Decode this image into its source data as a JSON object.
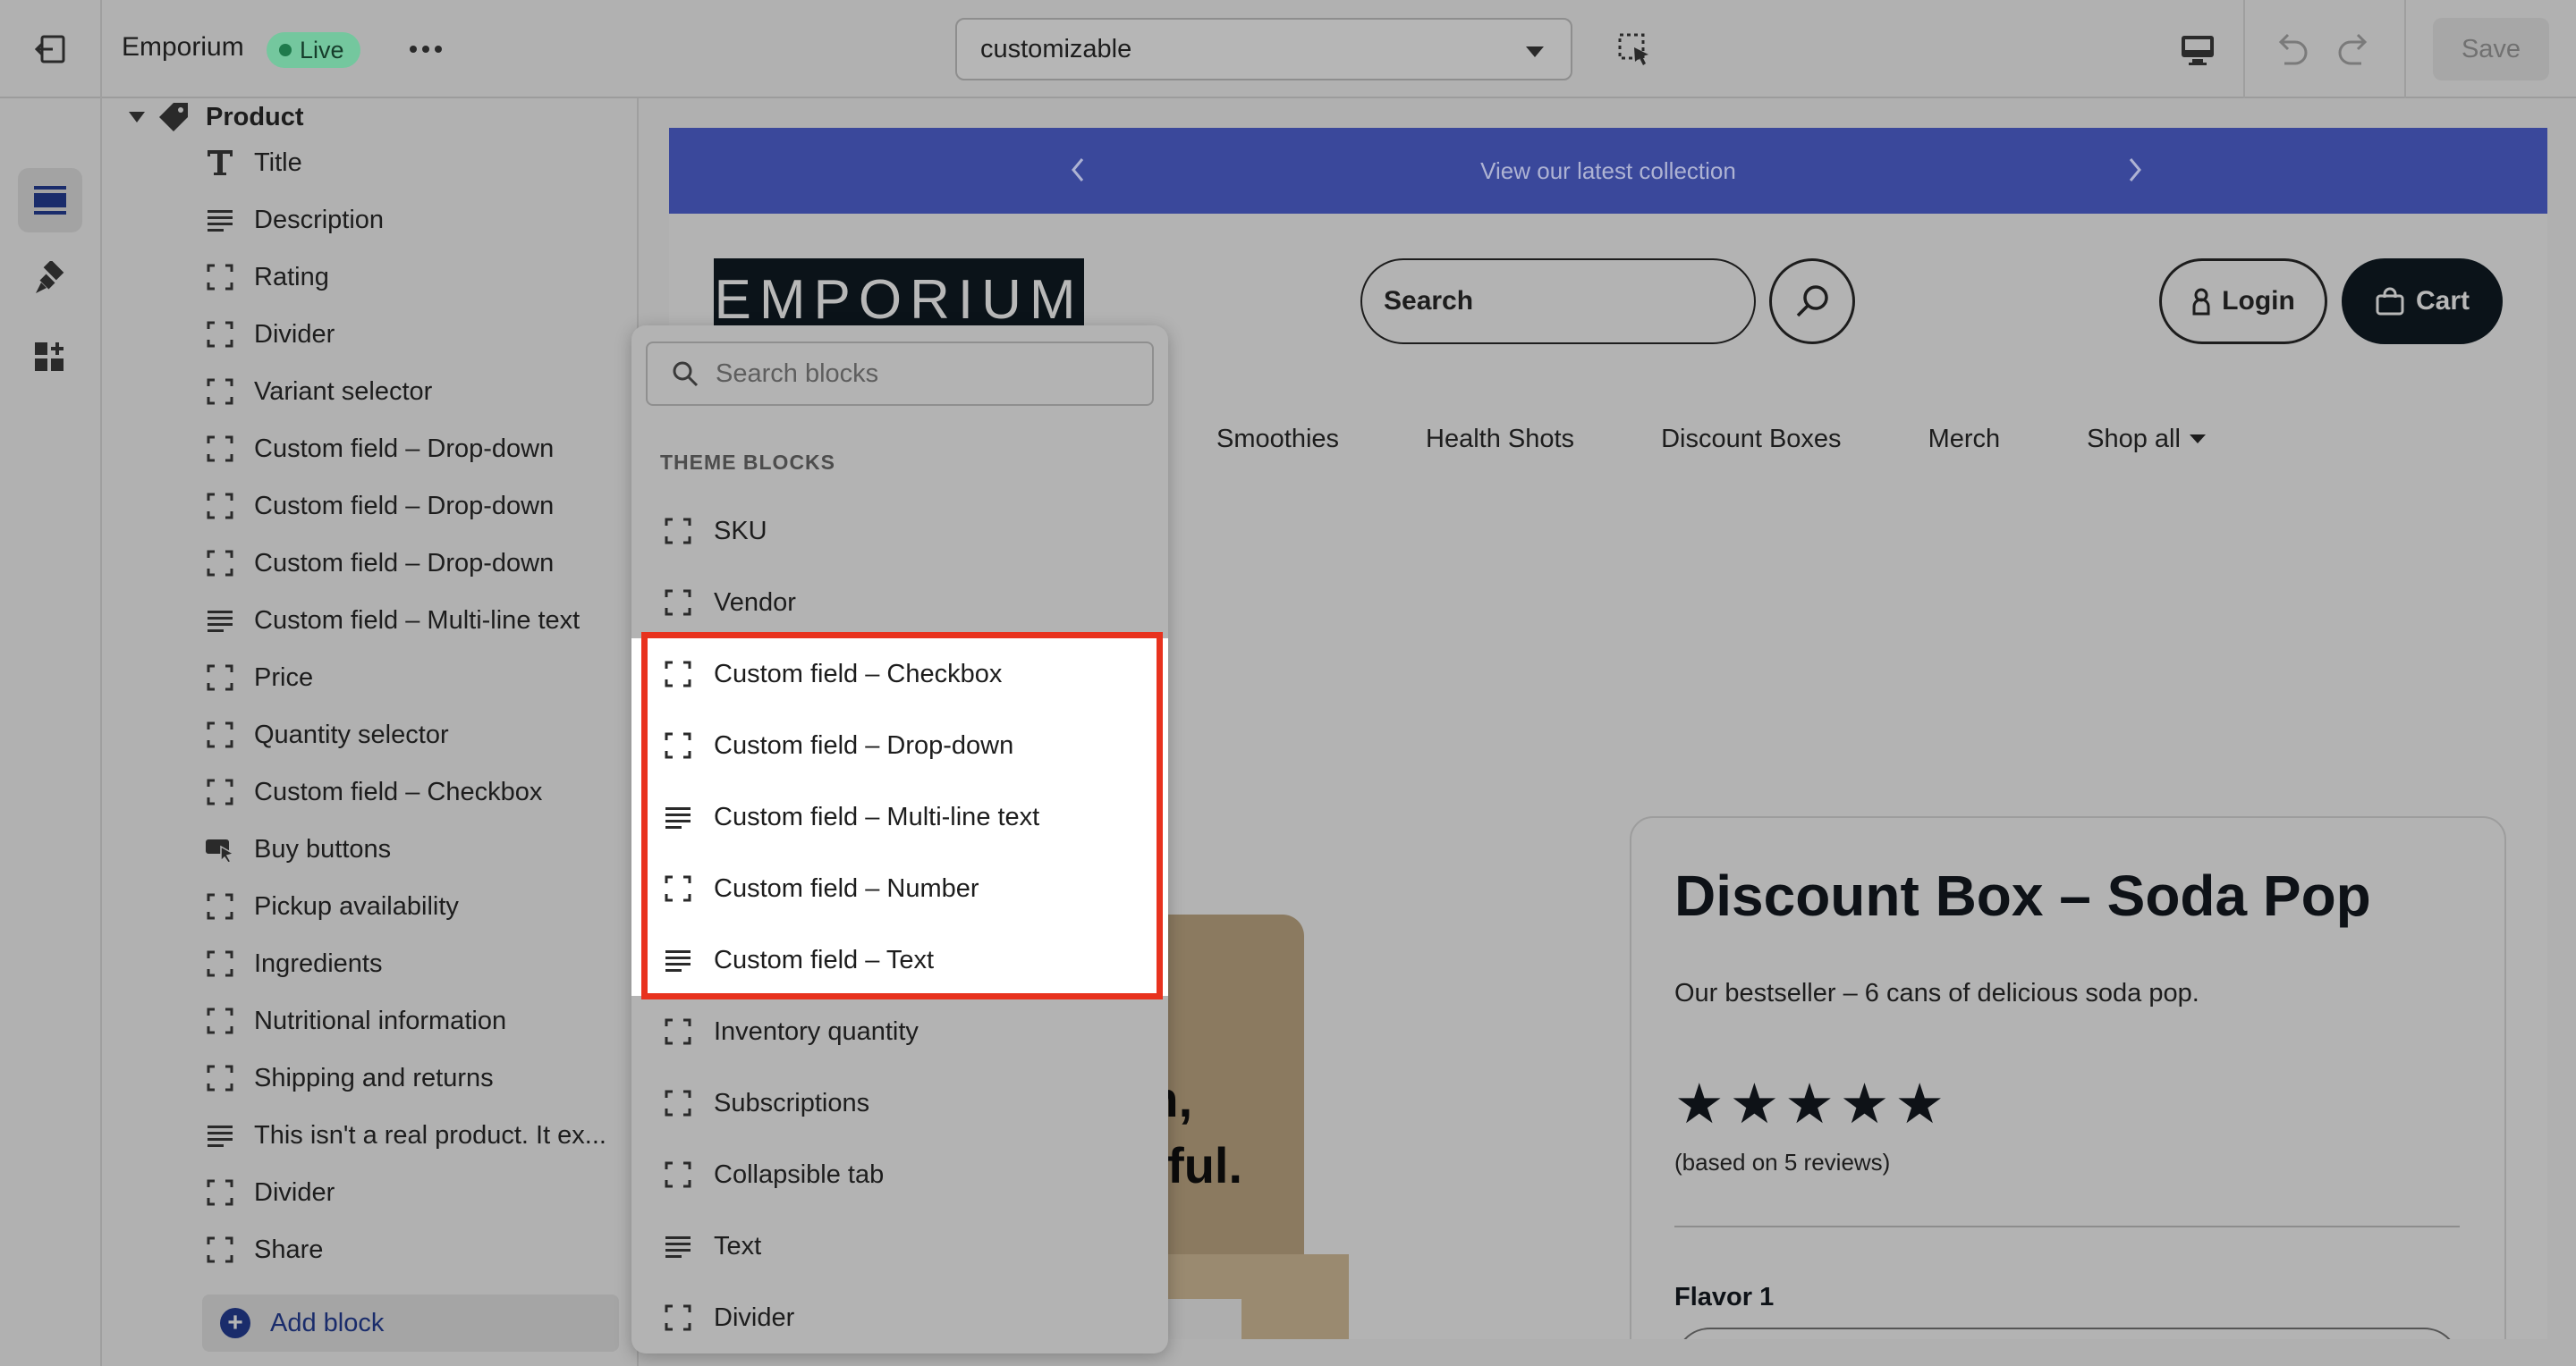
{
  "topbar": {
    "store_name": "Emporium",
    "live_label": "Live",
    "template_value": "customizable",
    "save_label": "Save"
  },
  "sidebar": {
    "section_title": "Product",
    "blocks": [
      {
        "label": "Title",
        "icon": "text-icon"
      },
      {
        "label": "Description",
        "icon": "lines-icon"
      },
      {
        "label": "Rating",
        "icon": "dashed-square-icon"
      },
      {
        "label": "Divider",
        "icon": "dashed-square-icon"
      },
      {
        "label": "Variant selector",
        "icon": "dashed-square-icon"
      },
      {
        "label": "Custom field – Drop-down",
        "icon": "dashed-square-icon"
      },
      {
        "label": "Custom field – Drop-down",
        "icon": "dashed-square-icon"
      },
      {
        "label": "Custom field – Drop-down",
        "icon": "dashed-square-icon"
      },
      {
        "label": "Custom field – Multi-line text",
        "icon": "lines-icon"
      },
      {
        "label": "Price",
        "icon": "dashed-square-icon"
      },
      {
        "label": "Quantity selector",
        "icon": "dashed-square-icon"
      },
      {
        "label": "Custom field – Checkbox",
        "icon": "dashed-square-icon"
      },
      {
        "label": "Buy buttons",
        "icon": "buy-button-icon"
      },
      {
        "label": "Pickup availability",
        "icon": "dashed-square-icon"
      },
      {
        "label": "Ingredients",
        "icon": "dashed-square-icon"
      },
      {
        "label": "Nutritional information",
        "icon": "dashed-square-icon"
      },
      {
        "label": "Shipping and returns",
        "icon": "dashed-square-icon"
      },
      {
        "label": "This isn't a real product. It ex...",
        "icon": "lines-icon"
      },
      {
        "label": "Divider",
        "icon": "dashed-square-icon"
      },
      {
        "label": "Share",
        "icon": "dashed-square-icon"
      }
    ],
    "add_block_label": "Add block"
  },
  "picker": {
    "search_placeholder": "Search blocks",
    "heading": "THEME BLOCKS",
    "items": [
      {
        "label": "SKU",
        "icon": "dashed-square-icon",
        "highlighted": false
      },
      {
        "label": "Vendor",
        "icon": "dashed-square-icon",
        "highlighted": false
      },
      {
        "label": "Custom field – Checkbox",
        "icon": "dashed-square-icon",
        "highlighted": true
      },
      {
        "label": "Custom field – Drop-down",
        "icon": "dashed-square-icon",
        "highlighted": true
      },
      {
        "label": "Custom field – Multi-line text",
        "icon": "lines-icon",
        "highlighted": true
      },
      {
        "label": "Custom field – Number",
        "icon": "dashed-square-icon",
        "highlighted": true
      },
      {
        "label": "Custom field – Text",
        "icon": "lines-icon",
        "highlighted": true
      },
      {
        "label": "Inventory quantity",
        "icon": "dashed-square-icon",
        "highlighted": false
      },
      {
        "label": "Subscriptions",
        "icon": "dashed-square-icon",
        "highlighted": false
      },
      {
        "label": "Collapsible tab",
        "icon": "dashed-square-icon",
        "highlighted": false
      },
      {
        "label": "Text",
        "icon": "lines-icon",
        "highlighted": false
      },
      {
        "label": "Divider",
        "icon": "dashed-square-icon",
        "highlighted": false
      }
    ],
    "highlight_color": "#e8321e"
  },
  "preview": {
    "announcement": "View our latest collection",
    "logo_text": "EMPORIUM",
    "search_label": "Search",
    "login_label": "Login",
    "cart_label": "Cart",
    "nav_items": [
      "Smoothies",
      "Health Shots",
      "Discount Boxes",
      "Merch",
      "Shop all"
    ],
    "box_text_line1": "mm,",
    "box_text_line2": "ghtful.",
    "product_title": "Discount Box – Soda Pop",
    "product_description": "Our bestseller – 6 cans of delicious soda pop.",
    "rating": 5,
    "rating_max": 5,
    "reviews_text": "(based on 5 reviews)",
    "flavor_label": "Flavor 1",
    "announcement_bg": "#3a489b"
  }
}
